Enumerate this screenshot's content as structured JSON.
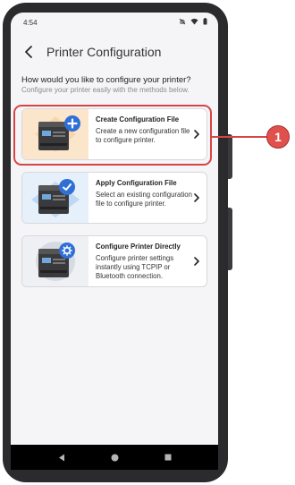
{
  "status_bar": {
    "time": "4:54"
  },
  "header": {
    "title": "Printer Configuration"
  },
  "intro": {
    "question": "How would you like to configure your printer?",
    "subtitle": "Configure your printer easily with the methods below."
  },
  "options": [
    {
      "title": "Create Configuration File",
      "description": "Create a new configuration file to configure printer.",
      "badge_icon": "plus-icon",
      "accent": "#2f6fd6"
    },
    {
      "title": "Apply Configuration File",
      "description": "Select an existing configuration file to configure printer.",
      "badge_icon": "check-icon",
      "accent": "#2f6fd6"
    },
    {
      "title": "Configure Printer Directly",
      "description": "Configure printer settings instantly using TCPIP or Bluetooth connection.",
      "badge_icon": "gear-icon",
      "accent": "#2f6fd6"
    }
  ],
  "annotation": {
    "callout_number": "1",
    "color": "#d64545"
  }
}
